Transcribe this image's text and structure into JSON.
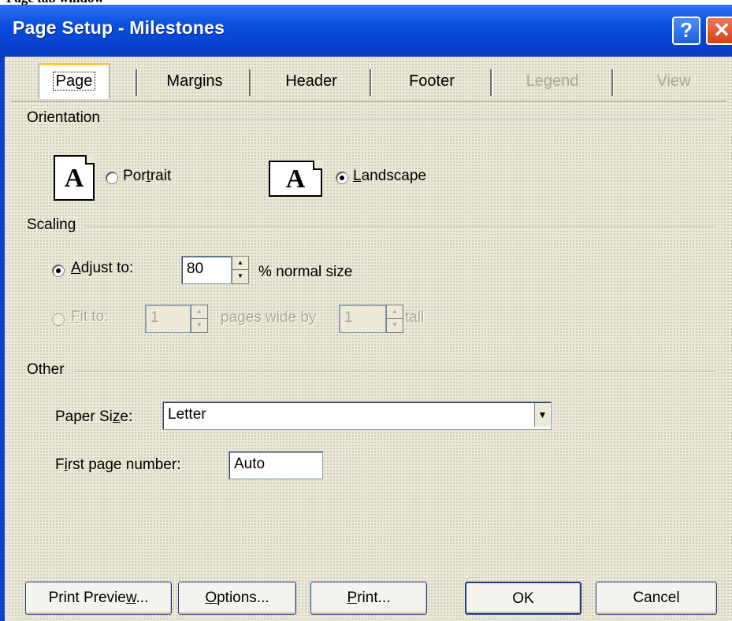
{
  "caption": "Page tab window",
  "window": {
    "title": "Page Setup - Milestones",
    "help_glyph": "?",
    "close_glyph": "✕"
  },
  "tabs": [
    {
      "label": "Page",
      "selected": true,
      "enabled": true
    },
    {
      "label": "Margins",
      "selected": false,
      "enabled": true
    },
    {
      "label": "Header",
      "selected": false,
      "enabled": true
    },
    {
      "label": "Footer",
      "selected": false,
      "enabled": true
    },
    {
      "label": "Legend",
      "selected": false,
      "enabled": false
    },
    {
      "label": "View",
      "selected": false,
      "enabled": false
    }
  ],
  "orientation": {
    "group_label": "Orientation",
    "icon_glyph": "A",
    "portrait_pre": "Por",
    "portrait_key": "t",
    "portrait_post": "rait",
    "landscape_key": "L",
    "landscape_post": "andscape",
    "selected": "landscape"
  },
  "scaling": {
    "group_label": "Scaling",
    "adjust_key": "A",
    "adjust_post": "djust to:",
    "adjust_value": "80",
    "adjust_suffix": "% normal size",
    "fit_key": "F",
    "fit_post": "it to:",
    "fit_wide_value": "1",
    "fit_mid_label": "pages wide by",
    "fit_tall_value": "1",
    "fit_tall_label": "tall",
    "selected": "adjust",
    "spin_up": "▲",
    "spin_down": "▼"
  },
  "other": {
    "group_label": "Other",
    "paper_size_pre": "Paper Si",
    "paper_size_key": "z",
    "paper_size_post": "e:",
    "paper_size_value": "Letter",
    "combo_arrow": "▼",
    "first_page_pre": "F",
    "first_page_key": "i",
    "first_page_post": "rst page number:",
    "first_page_value": "Auto"
  },
  "buttons": {
    "print_preview_pre": "Print Previe",
    "print_preview_key": "w",
    "print_preview_post": "...",
    "options_key": "O",
    "options_post": "ptions...",
    "print_key": "P",
    "print_post": "rint...",
    "ok": "OK",
    "cancel": "Cancel"
  }
}
